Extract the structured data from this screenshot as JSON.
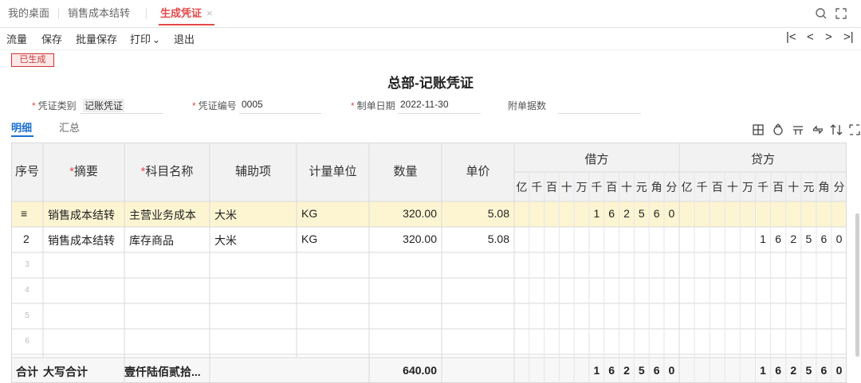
{
  "tabs": [
    {
      "label": "我的桌面",
      "active": false
    },
    {
      "label": "销售成本结转",
      "active": false
    },
    {
      "label": "生成凭证",
      "active": true
    }
  ],
  "tab_close": "×",
  "toolbar": {
    "items": [
      "流量",
      "保存",
      "批量保存",
      "打印",
      "退出"
    ],
    "print_caret": "⌄",
    "nav": [
      "|<",
      "<",
      ">",
      ">|"
    ]
  },
  "badge": "已生成",
  "title": "总部-记账凭证",
  "fields": {
    "type_label": "凭证类别",
    "type_value": "记账凭证",
    "number_label": "凭证编号",
    "number_value": "0005",
    "date_label": "制单日期",
    "date_value": "2022-11-30",
    "attach_label": "附单据数",
    "attach_value": ""
  },
  "subtabs": [
    "明细",
    "汇总"
  ],
  "table": {
    "headers": {
      "seq": "序号",
      "summary": "摘要",
      "account": "科目名称",
      "aux": "辅助项",
      "unit": "计量单位",
      "qty": "数量",
      "price": "单价",
      "debit": "借方",
      "credit": "贷方"
    },
    "debit_units": [
      "亿",
      "千",
      "百",
      "十",
      "万",
      "千",
      "百",
      "十",
      "元",
      "角",
      "分"
    ],
    "credit_units": [
      "亿",
      "千",
      "百",
      "十",
      "万",
      "千",
      "百",
      "十",
      "元",
      "角",
      "分"
    ],
    "rows": [
      {
        "seq": "≡",
        "summary": "销售成本结转",
        "account": "主营业务成本",
        "aux": "大米",
        "unit": "KG",
        "qty": "320.00",
        "price": "5.08",
        "debit_digits": [
          "",
          "",
          "",
          "",
          "",
          "1",
          "6",
          "2",
          "5",
          "6",
          "0"
        ],
        "credit_digits": [
          "",
          "",
          "",
          "",
          "",
          "",
          "",
          "",
          "",
          "",
          ""
        ]
      },
      {
        "seq": "2",
        "summary": "销售成本结转",
        "account": "库存商品",
        "aux": "大米",
        "unit": "KG",
        "qty": "320.00",
        "price": "5.08",
        "debit_digits": [
          "",
          "",
          "",
          "",
          "",
          "",
          "",
          "",
          "",
          "",
          ""
        ],
        "credit_digits": [
          "",
          "",
          "",
          "",
          "",
          "1",
          "6",
          "2",
          "5",
          "6",
          "0"
        ]
      },
      {
        "seq": "3"
      },
      {
        "seq": "4"
      },
      {
        "seq": "5"
      },
      {
        "seq": "6"
      }
    ],
    "total": {
      "label": "合计",
      "caps_label": "大写合计",
      "caps_value": "壹仟陆佰贰拾...",
      "qty": "640.00",
      "debit_digits": [
        "",
        "",
        "",
        "",
        "",
        "1",
        "6",
        "2",
        "5",
        "6",
        "0"
      ],
      "credit_digits": [
        "",
        "",
        "",
        "",
        "",
        "1",
        "6",
        "2",
        "5",
        "6",
        "0"
      ]
    }
  },
  "colors": {
    "accent": "#e34a4a",
    "blue": "#1a6fd1",
    "highlight": "#fdf5d2",
    "header_bg": "#f2f2f2"
  }
}
